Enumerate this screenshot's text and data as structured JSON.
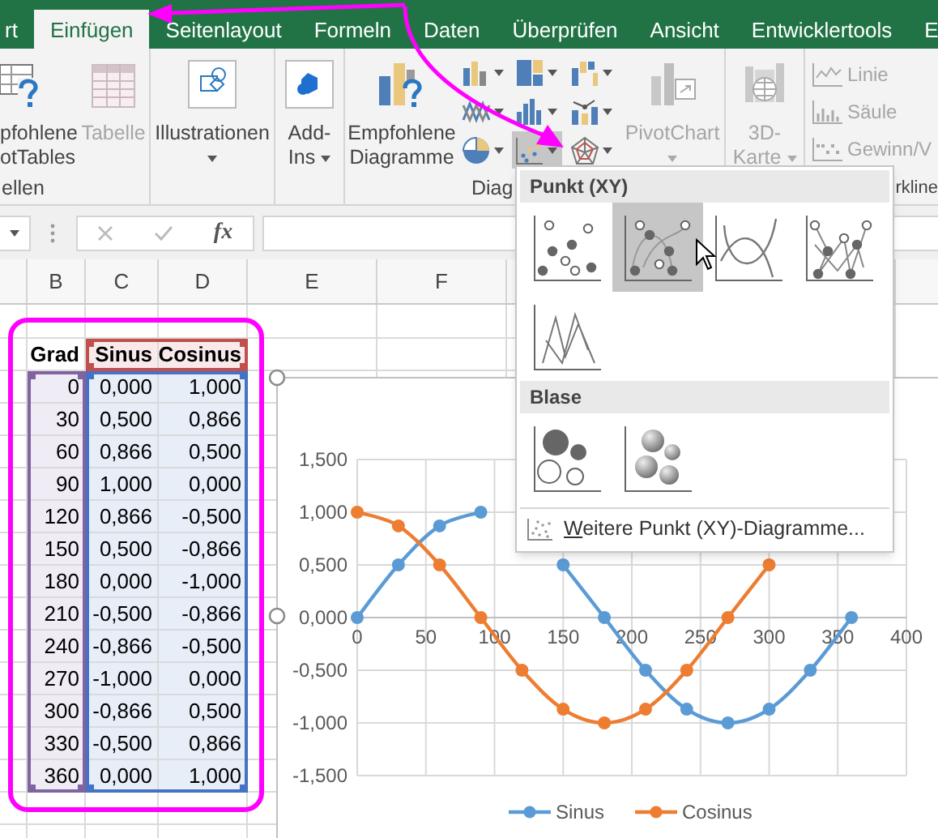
{
  "tabs": [
    {
      "label": "rt",
      "selected": false
    },
    {
      "label": "Einfügen",
      "selected": true
    },
    {
      "label": "Seitenlayout",
      "selected": false
    },
    {
      "label": "Formeln",
      "selected": false
    },
    {
      "label": "Daten",
      "selected": false
    },
    {
      "label": "Überprüfen",
      "selected": false
    },
    {
      "label": "Ansicht",
      "selected": false
    },
    {
      "label": "Entwicklertools",
      "selected": false
    },
    {
      "label": "E",
      "selected": false
    }
  ],
  "ribbon": {
    "groups": [
      {
        "label": "ellen",
        "items": [
          {
            "kind": "pivottable",
            "lines": [
              "pfohlene",
              "otTables"
            ],
            "disabled": false,
            "dropdown": false
          },
          {
            "kind": "table",
            "lines": [
              "Tabelle"
            ],
            "disabled": true,
            "dropdown": false
          }
        ]
      },
      {
        "items": [
          {
            "kind": "illustrations",
            "lines": [
              "Illustrationen"
            ],
            "disabled": false,
            "dropdown": true
          }
        ]
      },
      {
        "items": [
          {
            "kind": "addins",
            "lines": [
              "Add-",
              "Ins"
            ],
            "disabled": false,
            "dropdown": true
          }
        ]
      },
      {
        "label": "Diag",
        "items": [
          {
            "kind": "recommended",
            "lines": [
              "Empfohlene",
              "Diagramme"
            ],
            "disabled": false,
            "dropdown": false
          },
          {
            "kind": "gallery",
            "charts": [
              {
                "kind": "column",
                "selected": false
              },
              {
                "kind": "treemap",
                "selected": false
              },
              {
                "kind": "waterfall",
                "selected": false
              },
              {
                "kind": "line",
                "selected": false
              },
              {
                "kind": "histogram",
                "selected": false
              },
              {
                "kind": "combo",
                "selected": false
              },
              {
                "kind": "pie",
                "selected": false
              },
              {
                "kind": "scatter",
                "selected": true
              },
              {
                "kind": "radar",
                "selected": false
              }
            ]
          },
          {
            "kind": "pivotchart",
            "lines": [
              "PivotChart"
            ],
            "disabled": true,
            "dropdown": true
          }
        ]
      },
      {
        "items": [
          {
            "kind": "map",
            "lines": [
              "3D-",
              "Karte"
            ],
            "disabled": true,
            "dropdown": true
          }
        ]
      },
      {
        "label": "rkline",
        "items": [
          {
            "kind": "sparklines",
            "disabled": true,
            "entries": [
              {
                "kind": "line",
                "label": "Linie"
              },
              {
                "kind": "column",
                "label": "Säule"
              },
              {
                "kind": "winloss",
                "label": "Gewinn/V"
              }
            ]
          }
        ]
      }
    ]
  },
  "formula_bar": {
    "function_label": "fx"
  },
  "sheet": {
    "column_headers": [
      "B",
      "C",
      "D",
      "E",
      "F"
    ],
    "header_row": [
      "Grad",
      "Sinus",
      "Cosinus"
    ],
    "rows": [
      [
        "0",
        "0,000",
        "1,000"
      ],
      [
        "30",
        "0,500",
        "0,866"
      ],
      [
        "60",
        "0,866",
        "0,500"
      ],
      [
        "90",
        "1,000",
        "0,000"
      ],
      [
        "120",
        "0,866",
        "-0,500"
      ],
      [
        "150",
        "0,500",
        "-0,866"
      ],
      [
        "180",
        "0,000",
        "-1,000"
      ],
      [
        "210",
        "-0,500",
        "-0,866"
      ],
      [
        "240",
        "-0,866",
        "-0,500"
      ],
      [
        "270",
        "-1,000",
        "0,000"
      ],
      [
        "300",
        "-0,866",
        "0,500"
      ],
      [
        "330",
        "-0,500",
        "0,866"
      ],
      [
        "360",
        "0,000",
        "1,000"
      ]
    ]
  },
  "chart": {
    "chart_data": {
      "type": "line",
      "x": [
        0,
        30,
        60,
        90,
        120,
        150,
        180,
        210,
        240,
        270,
        300,
        330,
        360
      ],
      "series": [
        {
          "name": "Sinus",
          "color": "#5b9bd5",
          "marker": "circle",
          "values": [
            0,
            0.5,
            0.87,
            1,
            null,
            0.5,
            0,
            -0.5,
            -0.87,
            -1,
            -0.87,
            -0.5,
            0
          ]
        },
        {
          "name": "Cosinus",
          "color": "#ed7d31",
          "marker": "circle",
          "values": [
            1,
            0.87,
            0.5,
            0,
            -0.5,
            -0.87,
            -1,
            -0.87,
            -0.5,
            0,
            0.5,
            null,
            null
          ]
        }
      ],
      "xlim": [
        0,
        400
      ],
      "ylim": [
        -1.5,
        1.5
      ],
      "xticks": [
        {
          "value": 0,
          "label": "0"
        },
        {
          "value": 50,
          "label": "50"
        },
        {
          "value": 100,
          "label": "100"
        },
        {
          "value": 150,
          "label": "150"
        },
        {
          "value": 200,
          "label": "200"
        },
        {
          "value": 250,
          "label": "250"
        },
        {
          "value": 300,
          "label": "300"
        },
        {
          "value": 350,
          "label": "350"
        },
        {
          "value": 400,
          "label": "400"
        }
      ],
      "yticks": [
        {
          "value": -1.5,
          "label": "-1,500"
        },
        {
          "value": -1,
          "label": "-1,000"
        },
        {
          "value": -0.5,
          "label": "-0,500"
        },
        {
          "value": 0,
          "label": "0,000"
        },
        {
          "value": 0.5,
          "label": "0,500"
        },
        {
          "value": 1,
          "label": "1,000"
        },
        {
          "value": 1.5,
          "label": "1,500"
        }
      ],
      "grid": true,
      "legend": "bottom"
    }
  },
  "chart_menu": {
    "sections": [
      {
        "title": "Punkt (XY)",
        "items": [
          {
            "kind": "markers",
            "selected": false
          },
          {
            "kind": "smoothmarkers",
            "selected": true
          },
          {
            "kind": "smooth",
            "selected": false
          },
          {
            "kind": "straightmarkers",
            "selected": false
          },
          {
            "kind": "straight",
            "selected": false
          }
        ]
      },
      {
        "title": "Blase",
        "items": [
          {
            "kind": "bubble",
            "selected": false
          },
          {
            "kind": "bubble3d",
            "selected": false
          }
        ]
      }
    ],
    "footer_link": "Weitere Punkt (XY)-Diagramme..."
  }
}
